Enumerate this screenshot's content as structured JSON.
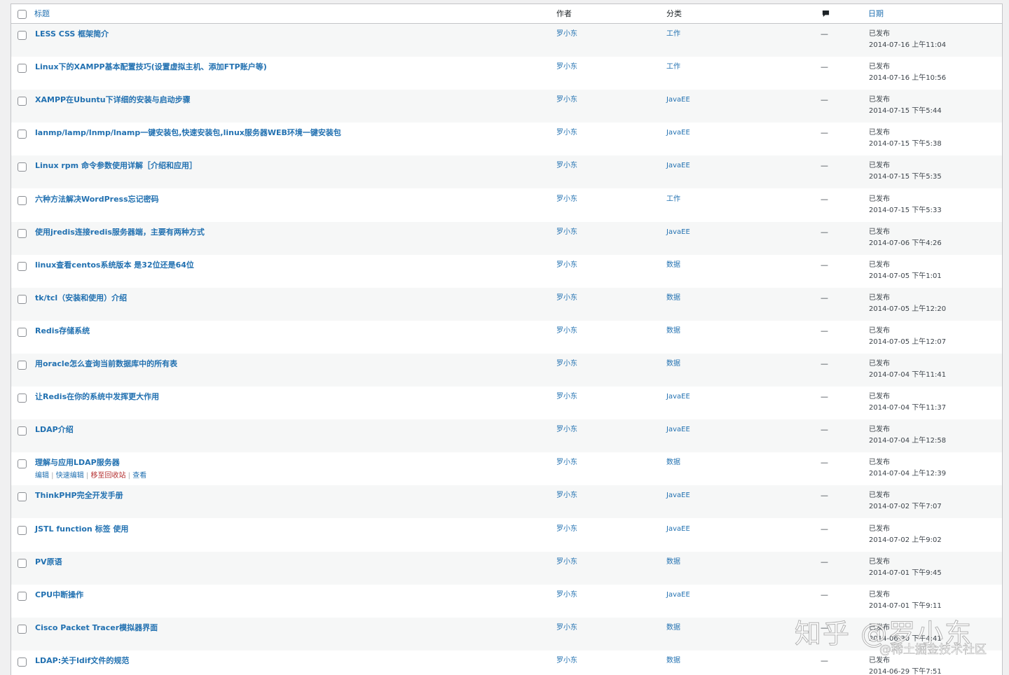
{
  "columns": {
    "title": "标题",
    "author": "作者",
    "category": "分类",
    "comments_icon": "comment-bubble-icon",
    "date": "日期"
  },
  "row_actions": {
    "edit": "编辑",
    "quick_edit": "快速编辑",
    "trash": "移至回收站",
    "view": "查看"
  },
  "colors": {
    "link": "#2271b1",
    "trash": "#b32d2e",
    "alt_row": "#f6f7f7"
  },
  "posts": [
    {
      "title": "LESS CSS 框架简介",
      "author": "罗小东",
      "category": "工作",
      "comments": "—",
      "status": "已发布",
      "date": "2014-07-16 上午11:04"
    },
    {
      "title": "Linux下的XAMPP基本配置技巧(设置虚拟主机、添加FTP账户等)",
      "author": "罗小东",
      "category": "工作",
      "comments": "—",
      "status": "已发布",
      "date": "2014-07-16 上午10:56"
    },
    {
      "title": "XAMPP在Ubuntu下详细的安装与启动步骤",
      "author": "罗小东",
      "category": "JavaEE",
      "comments": "—",
      "status": "已发布",
      "date": "2014-07-15 下午5:44"
    },
    {
      "title": "lanmp/lamp/lnmp/lnamp一键安装包,快速安装包,linux服务器WEB环境一键安装包",
      "author": "罗小东",
      "category": "JavaEE",
      "comments": "—",
      "status": "已发布",
      "date": "2014-07-15 下午5:38"
    },
    {
      "title": "Linux rpm 命令参数使用详解［介绍和应用］",
      "author": "罗小东",
      "category": "JavaEE",
      "comments": "—",
      "status": "已发布",
      "date": "2014-07-15 下午5:35"
    },
    {
      "title": "六种方法解决WordPress忘记密码",
      "author": "罗小东",
      "category": "工作",
      "comments": "—",
      "status": "已发布",
      "date": "2014-07-15 下午5:33"
    },
    {
      "title": "使用jredis连接redis服务器端，主要有两种方式",
      "author": "罗小东",
      "category": "JavaEE",
      "comments": "—",
      "status": "已发布",
      "date": "2014-07-06 下午4:26"
    },
    {
      "title": "linux查看centos系统版本 是32位还是64位",
      "author": "罗小东",
      "category": "数据",
      "comments": "—",
      "status": "已发布",
      "date": "2014-07-05 下午1:01"
    },
    {
      "title": "tk/tcl（安装和使用）介绍",
      "author": "罗小东",
      "category": "数据",
      "comments": "—",
      "status": "已发布",
      "date": "2014-07-05 上午12:20"
    },
    {
      "title": "Redis存储系统",
      "author": "罗小东",
      "category": "数据",
      "comments": "—",
      "status": "已发布",
      "date": "2014-07-05 上午12:07"
    },
    {
      "title": "用oracle怎么查询当前数据库中的所有表",
      "author": "罗小东",
      "category": "数据",
      "comments": "—",
      "status": "已发布",
      "date": "2014-07-04 下午11:41"
    },
    {
      "title": "让Redis在你的系统中发挥更大作用",
      "author": "罗小东",
      "category": "JavaEE",
      "comments": "—",
      "status": "已发布",
      "date": "2014-07-04 下午11:37"
    },
    {
      "title": "LDAP介绍",
      "author": "罗小东",
      "category": "JavaEE",
      "comments": "—",
      "status": "已发布",
      "date": "2014-07-04 上午12:58"
    },
    {
      "title": "理解与应用LDAP服务器",
      "author": "罗小东",
      "category": "数据",
      "comments": "—",
      "status": "已发布",
      "date": "2014-07-04 上午12:39"
    },
    {
      "title": "ThinkPHP完全开发手册",
      "author": "罗小东",
      "category": "JavaEE",
      "comments": "—",
      "status": "已发布",
      "date": "2014-07-02 下午7:07"
    },
    {
      "title": "JSTL function 标签 使用",
      "author": "罗小东",
      "category": "JavaEE",
      "comments": "—",
      "status": "已发布",
      "date": "2014-07-02 上午9:02"
    },
    {
      "title": "PV原语",
      "author": "罗小东",
      "category": "数据",
      "comments": "—",
      "status": "已发布",
      "date": "2014-07-01 下午9:45"
    },
    {
      "title": "CPU中断操作",
      "author": "罗小东",
      "category": "JavaEE",
      "comments": "—",
      "status": "已发布",
      "date": "2014-07-01 下午9:11"
    },
    {
      "title": "Cisco Packet Tracer模拟器界面",
      "author": "罗小东",
      "category": "数据",
      "comments": "—",
      "status": "已发布",
      "date": "2014-06-30 下午4:41"
    },
    {
      "title": "LDAP:关于ldif文件的规范",
      "author": "罗小东",
      "category": "数据",
      "comments": "—",
      "status": "已发布",
      "date": "2014-06-29 下午7:51"
    }
  ],
  "hover_row_index": 13,
  "watermark": {
    "main": "知乎 @罗小东",
    "sub": "@稀土掘金技术社区"
  }
}
